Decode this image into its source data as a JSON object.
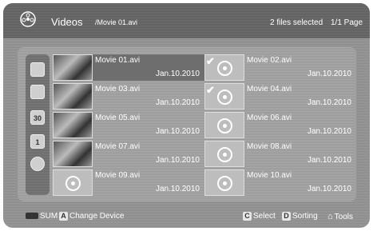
{
  "header": {
    "title": "Videos",
    "path": "/Movie 01.avi",
    "selected": "2 files selected",
    "page": "1/1 Page"
  },
  "sidebar": {
    "calendar_label": "30",
    "number_label": "1"
  },
  "items": [
    {
      "name": "Movie 01.avi",
      "date": "Jan.10.2010"
    },
    {
      "name": "Movie 02.avi",
      "date": "Jan.10.2010"
    },
    {
      "name": "Movie 03.avi",
      "date": "Jan.10.2010"
    },
    {
      "name": "Movie 04.avi",
      "date": "Jan.10.2010"
    },
    {
      "name": "Movie 05.avi",
      "date": "Jan.10.2010"
    },
    {
      "name": "Movie 06.avi",
      "date": "Jan.10.2010"
    },
    {
      "name": "Movie 07.avi",
      "date": "Jan.10.2010"
    },
    {
      "name": "Movie 08.avi",
      "date": "Jan.10.2010"
    },
    {
      "name": "Movie 09.avi",
      "date": "Jan.10.2010"
    },
    {
      "name": "Movie 10.avi",
      "date": "Jan.10.2010"
    }
  ],
  "footer": {
    "sum_label": "SUM",
    "a_key": "A",
    "change_device": "Change Device",
    "c_key": "C",
    "select": "Select",
    "d_key": "D",
    "sorting": "Sorting",
    "tools": "Tools"
  }
}
